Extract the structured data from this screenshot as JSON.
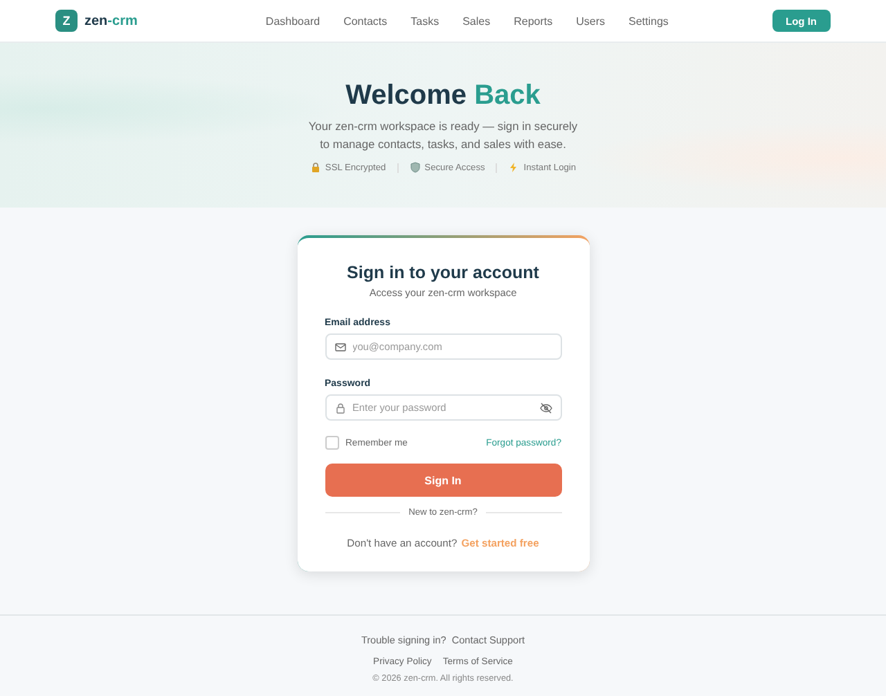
{
  "header": {
    "logo_letter": "Z",
    "brand": "zen",
    "brand_accent": "-crm",
    "nav": [
      {
        "label": "Dashboard"
      },
      {
        "label": "Contacts"
      },
      {
        "label": "Tasks"
      },
      {
        "label": "Sales"
      },
      {
        "label": "Reports"
      },
      {
        "label": "Users"
      },
      {
        "label": "Settings"
      }
    ],
    "login_button": "Log In"
  },
  "hero": {
    "title": "Welcome",
    "title_accent": "Back",
    "subtitle": "Your zen-crm workspace is ready — sign in securely to manage contacts, tasks, and sales with ease.",
    "badges": [
      {
        "kind": "lock",
        "label": "SSL Encrypted"
      },
      {
        "kind": "shield",
        "label": "Secure Access"
      },
      {
        "kind": "bolt",
        "label": "Instant Login"
      }
    ]
  },
  "card": {
    "title": "Sign in to your account",
    "subtitle": "Access your zen-crm workspace",
    "email": {
      "label": "Email address",
      "placeholder": "you@company.com"
    },
    "password": {
      "label": "Password",
      "placeholder": "Enter your password"
    },
    "remember": {
      "label": "Remember me",
      "checked": false
    },
    "forgot": "Forgot password?",
    "submit": "Sign In",
    "divider": "New to zen-crm?",
    "signup_prompt": "Don't have an account?",
    "signup_link": "Get started free"
  },
  "footer": {
    "trouble": "Trouble signing in?",
    "support_link": "Contact Support",
    "links": [
      "Privacy Policy",
      "Terms of Service"
    ],
    "copyright": "© 2026 zen-crm. All rights reserved."
  }
}
